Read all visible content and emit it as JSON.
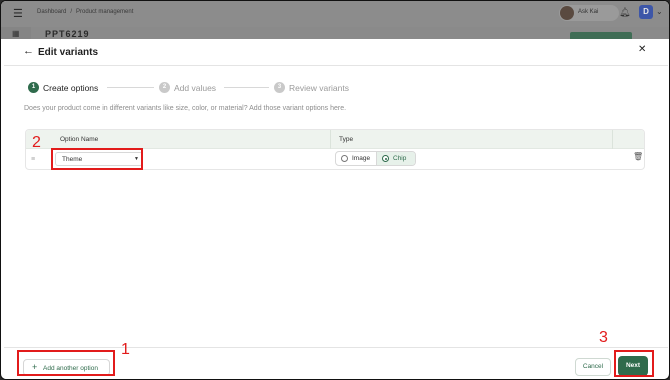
{
  "app": {
    "breadcrumb": [
      "Dashboard",
      "/",
      "Product management"
    ],
    "user_name": "Ask Kai",
    "avatar_letter": "D",
    "ghost_title": "PPT6219"
  },
  "modal": {
    "title": "Edit variants",
    "steps": [
      {
        "num": "1",
        "label": "Create options",
        "state": "active"
      },
      {
        "num": "2",
        "label": "Add values",
        "state": "inactive"
      },
      {
        "num": "3",
        "label": "Review variants",
        "state": "inactive"
      }
    ],
    "description": "Does your product come in different variants like size, color, or material? Add those variant options here.",
    "table": {
      "headers": {
        "name": "Option Name",
        "type": "Type"
      },
      "rows": [
        {
          "option_name": "Theme",
          "type_options": [
            "Image",
            "Chip"
          ],
          "selected_type": "Chip"
        }
      ]
    },
    "footer": {
      "add_label": "Add another option",
      "cancel_label": "Cancel",
      "next_label": "Next"
    }
  },
  "annotations": [
    "1",
    "2",
    "3"
  ],
  "colors": {
    "accent": "#2f6b4c",
    "annotation": "#e21b1b",
    "table_header": "#eef3ee"
  },
  "icons": [
    "menu-icon",
    "bell-icon",
    "chevron-down-icon",
    "arrow-left-icon",
    "close-icon",
    "drag-handle-icon",
    "trash-icon",
    "plus-icon"
  ]
}
